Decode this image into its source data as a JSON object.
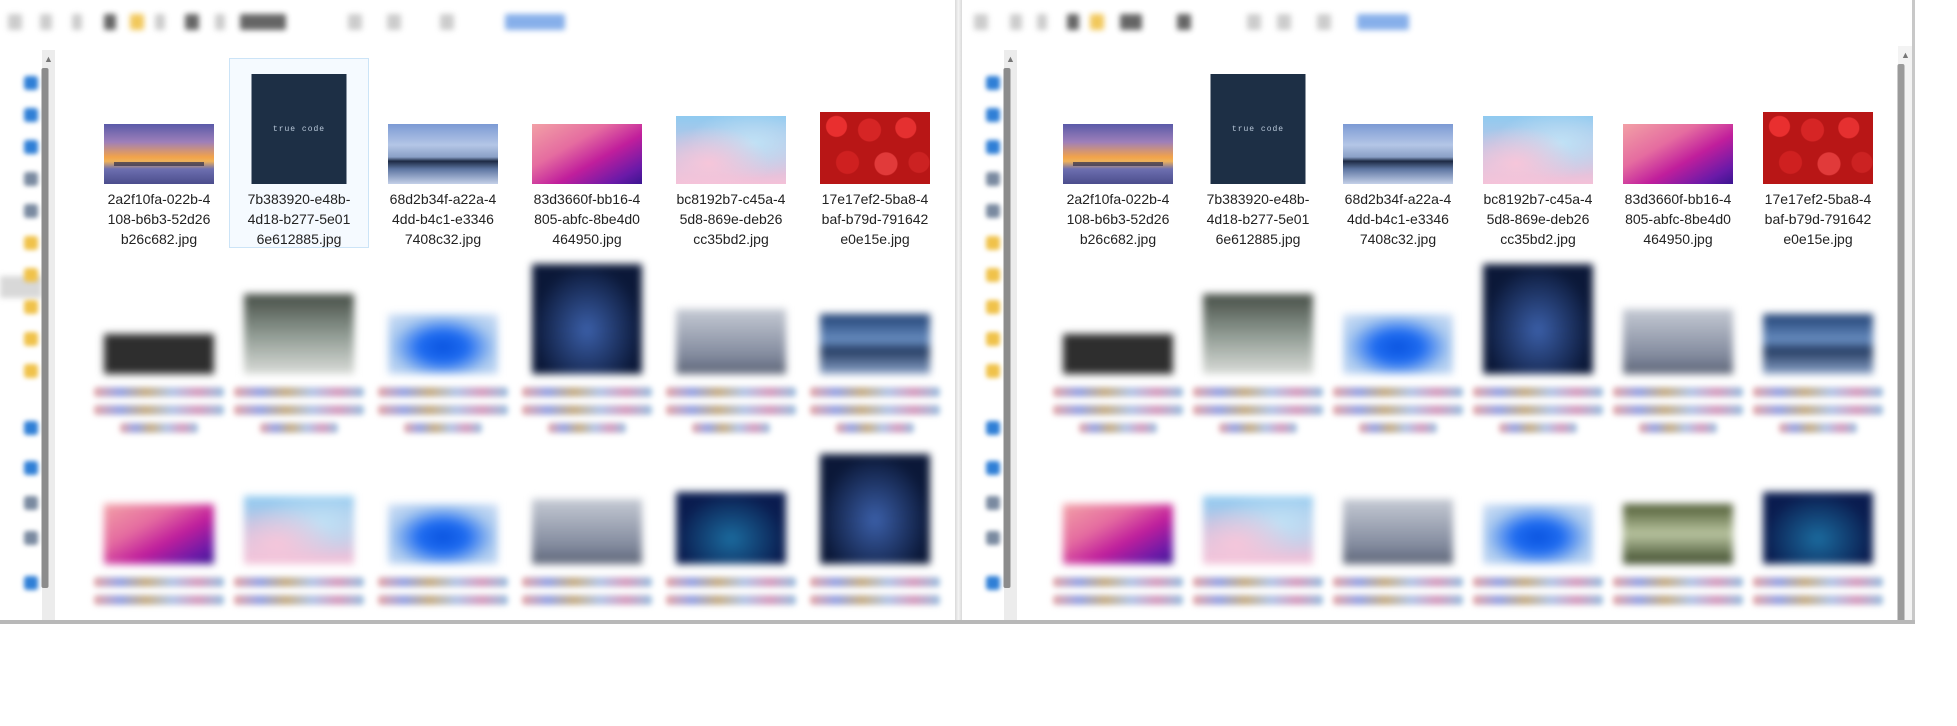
{
  "left": {
    "visible_files": [
      {
        "name": "2a2f10fa-022b-4108-b6b3-52d26b26c682.jpg",
        "lines": [
          "2a2f10fa-022b-4",
          "108-b6b3-52d26",
          "b26c682.jpg"
        ],
        "thumbnail": "sunset-reflection",
        "selected": false
      },
      {
        "name": "7b383920-e48b-4d18-b277-5e016e612885.jpg",
        "lines": [
          "7b383920-e48b-",
          "4d18-b277-5e01",
          "6e612885.jpg"
        ],
        "thumbnail": "true-code",
        "thumb_text": "true code",
        "selected": true
      },
      {
        "name": "68d2b34f-a22a-44dd-b4c1-e33467408c32.jpg",
        "lines": [
          "68d2b34f-a22a-4",
          "4dd-b4c1-e3346",
          "7408c32.jpg"
        ],
        "thumbnail": "city-skyline",
        "selected": false
      },
      {
        "name": "83d3660f-bb16-4805-abfc-8be4d0464950.jpg",
        "lines": [
          "83d3660f-bb16-4",
          "805-abfc-8be4d0",
          "464950.jpg"
        ],
        "thumbnail": "macos-wave",
        "selected": false
      },
      {
        "name": "bc8192b7-c45a-45d8-869e-deb26cc35bd2.jpg",
        "lines": [
          "bc8192b7-c45a-4",
          "5d8-869e-deb26",
          "cc35bd2.jpg"
        ],
        "thumbnail": "pastel-clouds",
        "selected": false
      },
      {
        "name": "17e17ef2-5ba8-4baf-b79d-791642e0e15e.jpg",
        "lines": [
          "17e17ef2-5ba8-4",
          "baf-b79d-791642",
          "e0e15e.jpg"
        ],
        "thumbnail": "strawberries",
        "selected": false
      }
    ],
    "blurred_thumbnails": [
      "dark",
      "ruins",
      "bloom",
      "night",
      "fog",
      "lake",
      "macos-wave",
      "pastel-clouds",
      "bloom",
      "fog",
      "deepblue",
      "night"
    ]
  },
  "right": {
    "visible_files": [
      {
        "name": "2a2f10fa-022b-4108-b6b3-52d26b26c682.jpg",
        "lines": [
          "2a2f10fa-022b-4",
          "108-b6b3-52d26",
          "b26c682.jpg"
        ],
        "thumbnail": "sunset-reflection"
      },
      {
        "name": "7b383920-e48b-4d18-b277-5e016e612885.jpg",
        "lines": [
          "7b383920-e48b-",
          "4d18-b277-5e01",
          "6e612885.jpg"
        ],
        "thumbnail": "true-code",
        "thumb_text": "true code"
      },
      {
        "name": "68d2b34f-a22a-44dd-b4c1-e33467408c32.jpg",
        "lines": [
          "68d2b34f-a22a-4",
          "4dd-b4c1-e3346",
          "7408c32.jpg"
        ],
        "thumbnail": "city-skyline"
      },
      {
        "name": "bc8192b7-c45a-45d8-869e-deb26cc35bd2.jpg",
        "lines": [
          "bc8192b7-c45a-4",
          "5d8-869e-deb26",
          "cc35bd2.jpg"
        ],
        "thumbnail": "pastel-clouds"
      },
      {
        "name": "83d3660f-bb16-4805-abfc-8be4d0464950.jpg",
        "lines": [
          "83d3660f-bb16-4",
          "805-abfc-8be4d0",
          "464950.jpg"
        ],
        "thumbnail": "macos-wave"
      },
      {
        "name": "17e17ef2-5ba8-4baf-b79d-791642e0e15e.jpg",
        "lines": [
          "17e17ef2-5ba8-4",
          "baf-b79d-791642",
          "e0e15e.jpg"
        ],
        "thumbnail": "strawberries"
      }
    ],
    "blurred_thumbnails": [
      "dark",
      "ruins",
      "bloom",
      "night",
      "fog",
      "lake",
      "macos-wave",
      "pastel-clouds",
      "fog",
      "bloom",
      "forest",
      "deepblue"
    ]
  },
  "colors": {
    "selection_border": "#cce4f7",
    "window_background": "#ffffff",
    "scrollbar_thumb": "#8c8c8c",
    "nav_icon_blue": "#2f7fd6",
    "nav_icon_folder": "#f0c24a"
  }
}
